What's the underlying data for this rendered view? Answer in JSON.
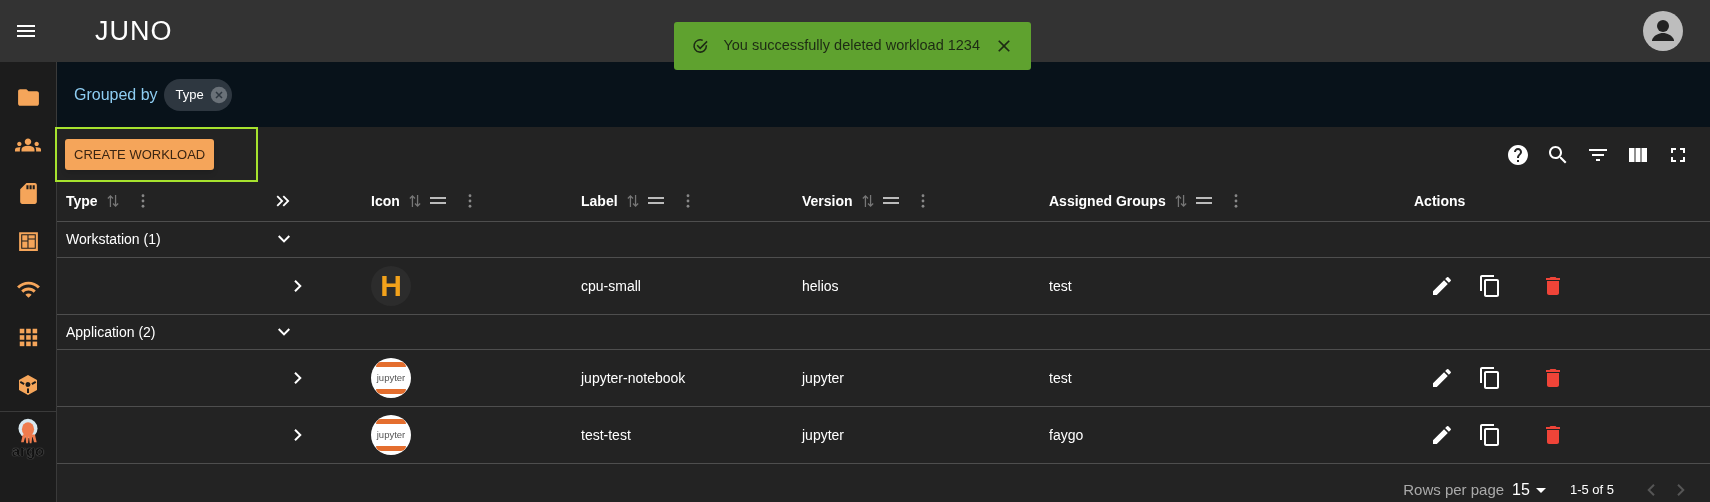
{
  "app_bar": {
    "logo": "JUNO"
  },
  "toast": {
    "message": "You successfully deleted workload 1234"
  },
  "sidebar": {
    "items": [
      {
        "kind": "folder"
      },
      {
        "kind": "people"
      },
      {
        "kind": "sdcard"
      },
      {
        "kind": "dashboard"
      },
      {
        "kind": "wifi"
      },
      {
        "kind": "apps"
      },
      {
        "kind": "cube"
      }
    ],
    "footer_logo": "argo"
  },
  "grouping": {
    "label": "Grouped by",
    "chips": [
      "Type"
    ]
  },
  "toolbar": {
    "create_button": "CREATE WORKLOAD",
    "highlighted": true,
    "tools": [
      {
        "kind": "help"
      },
      {
        "kind": "search"
      },
      {
        "kind": "filter"
      },
      {
        "kind": "columns"
      },
      {
        "kind": "fullscreen"
      }
    ]
  },
  "table": {
    "columns": [
      {
        "name": "Type",
        "sortable": true,
        "draggable": false,
        "menu": true
      },
      {
        "name": "Icon",
        "sortable": true,
        "draggable": true,
        "menu": true
      },
      {
        "name": "Label",
        "sortable": true,
        "draggable": true,
        "menu": true
      },
      {
        "name": "Version",
        "sortable": true,
        "draggable": true,
        "menu": true
      },
      {
        "name": "Assigned Groups",
        "sortable": true,
        "draggable": true,
        "menu": true
      },
      {
        "name": "Actions",
        "sortable": false,
        "draggable": false,
        "menu": false
      }
    ],
    "rows": [
      {
        "kind": "group",
        "label": "Workstation (1)",
        "expanded": true
      },
      {
        "kind": "item",
        "expanded": false,
        "icon": {
          "kind": "letter",
          "text": "H"
        },
        "label": "cpu-small",
        "version": "helios",
        "groups": "test"
      },
      {
        "kind": "group",
        "label": "Application (2)",
        "expanded": true
      },
      {
        "kind": "item",
        "expanded": false,
        "icon": {
          "kind": "jupyter",
          "text": "jupyter"
        },
        "label": "jupyter-notebook",
        "version": "jupyter",
        "groups": "test"
      },
      {
        "kind": "item",
        "expanded": false,
        "icon": {
          "kind": "jupyter",
          "text": "jupyter"
        },
        "label": "test-test",
        "version": "jupyter",
        "groups": "faygo"
      }
    ]
  },
  "pagination": {
    "rows_label": "Rows per page",
    "rows_value": "15",
    "range": "1-5 of 5",
    "prev_disabled": true,
    "next_disabled": true
  }
}
